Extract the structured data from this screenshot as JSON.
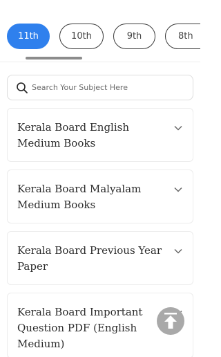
{
  "tabs": [
    {
      "label": "11th",
      "active": true
    },
    {
      "label": "10th",
      "active": false
    },
    {
      "label": "9th",
      "active": false
    },
    {
      "label": "8th",
      "active": false
    }
  ],
  "search": {
    "placeholder": "Search Your Subject Here",
    "icon": "search-icon"
  },
  "accordion": [
    {
      "title": "Kerala Board English Medium Books",
      "icon": "chevron-down-icon"
    },
    {
      "title": "Kerala Board Malyalam Medium Books",
      "icon": "chevron-down-icon"
    },
    {
      "title": "Kerala Board Previous Year Paper",
      "icon": "chevron-down-icon"
    },
    {
      "title": "Kerala Board Important Question PDF (English Medium)",
      "icon": "chevron-down-icon"
    }
  ],
  "back_to_top": {
    "icon": "arrow-up-icon"
  },
  "colors": {
    "accent": "#2f80ed",
    "text": "#2b2b2b",
    "back_to_top": "#a9a9a9"
  }
}
